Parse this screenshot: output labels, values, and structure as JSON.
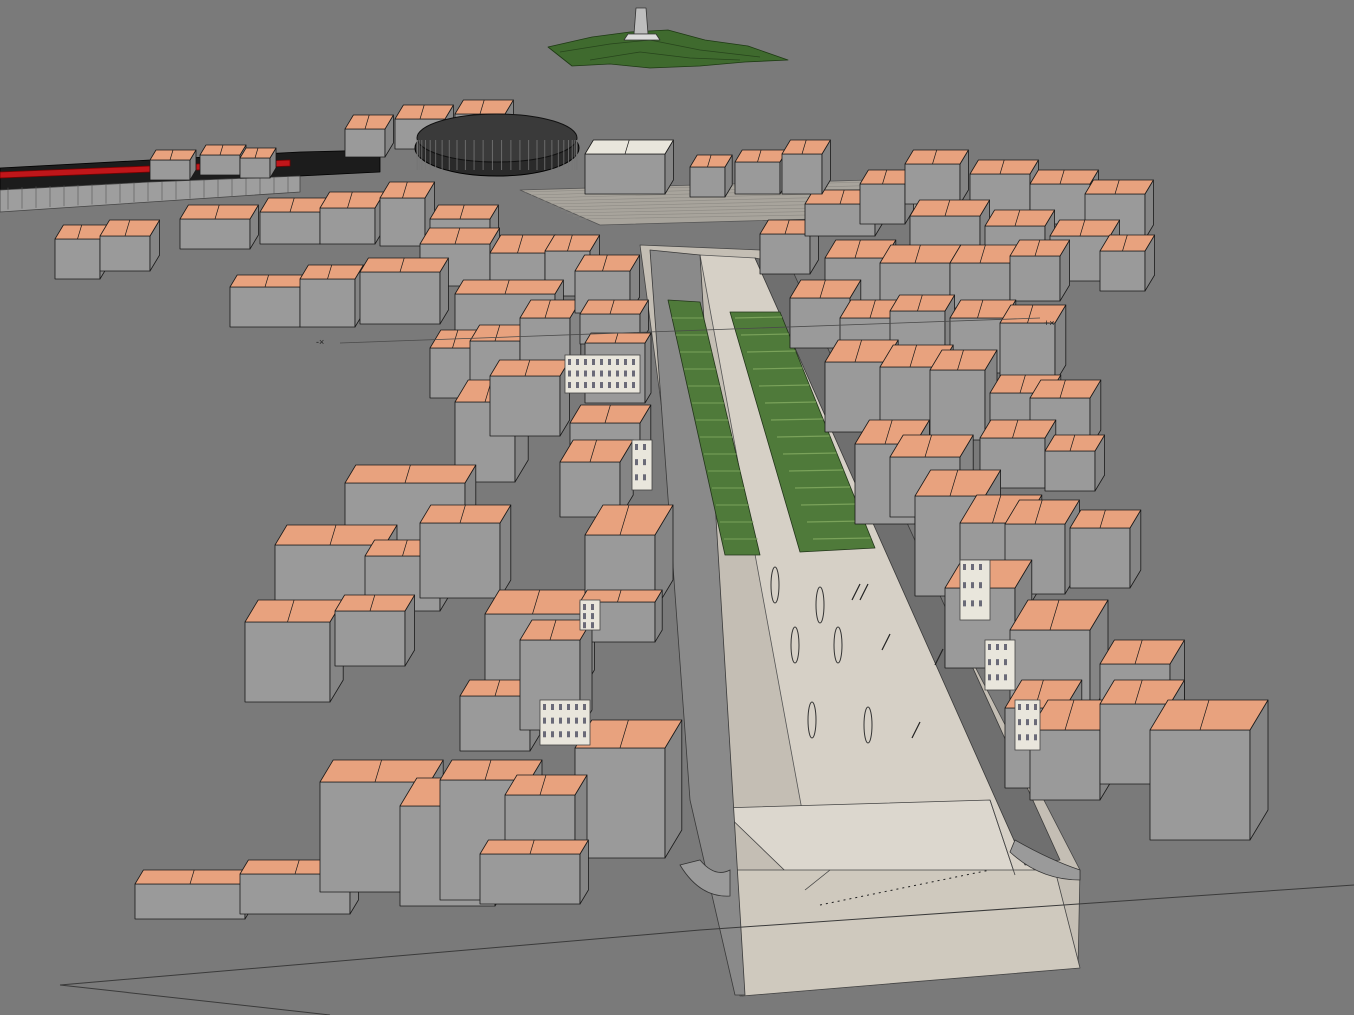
{
  "viewport": {
    "background_color": "#7a7a7a"
  },
  "palette": {
    "roof": "#e8a27e",
    "roof_edge": "#1a1a1a",
    "wall": "#9a9a9a",
    "wall_dark": "#858585",
    "plaza": "#d6d0c6",
    "plaza_dark": "#c4beb4",
    "garden": "#4f7a3a",
    "garden_light": "#7aa25a",
    "hill": "#3f6a2e",
    "road": "#6e6e6e",
    "facade": "#e9e6dc",
    "stadium": "#2a2a2a",
    "rail_red": "#c0161a",
    "rail_dark": "#1c1c1c"
  },
  "scene_objects": [
    "hill-terrain",
    "tower",
    "amphitheater",
    "rail-structure",
    "central-boulevard",
    "garden-strip",
    "plaza",
    "building-blocks"
  ],
  "axis_markers": {
    "left": "-×",
    "right": "+×"
  }
}
